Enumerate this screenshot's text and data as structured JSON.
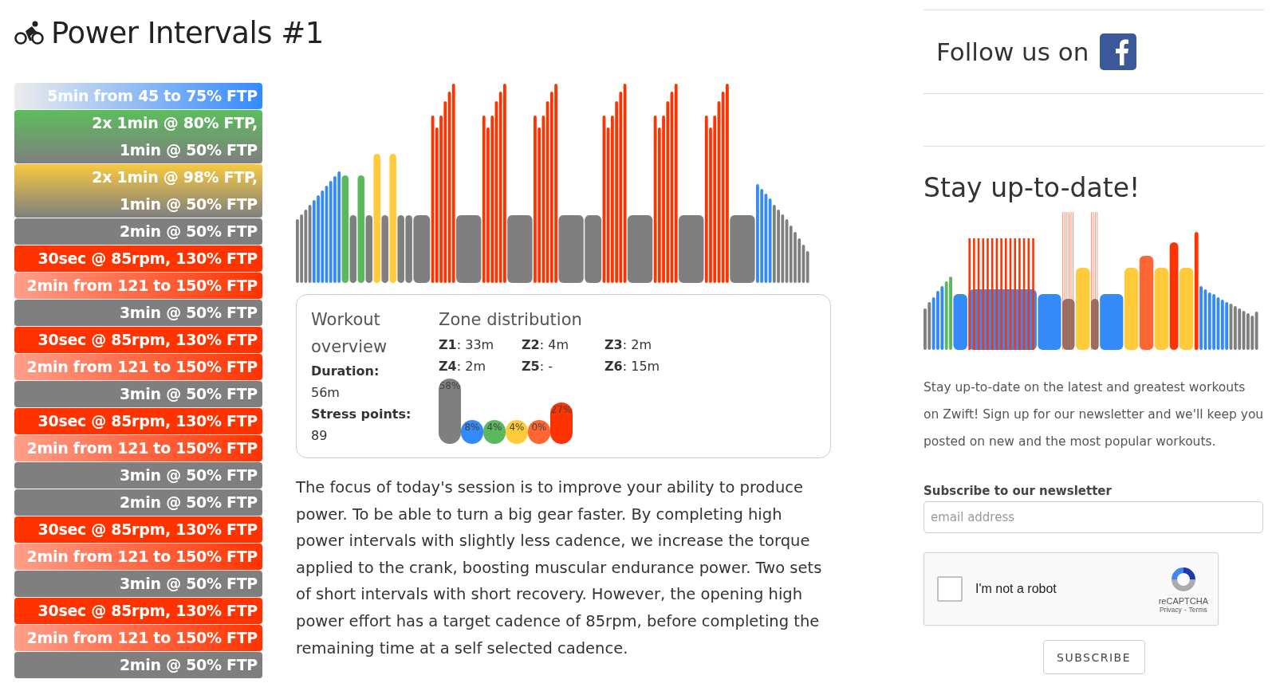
{
  "title": "Power Intervals #1",
  "intervals": [
    {
      "kind": "warmup",
      "lines": [
        "5min from 45 to 75% FTP"
      ]
    },
    {
      "kind": "tempo",
      "lines": [
        "2x 1min @ 80% FTP,",
        "1min @ 50% FTP"
      ]
    },
    {
      "kind": "threshold",
      "lines": [
        "2x 1min @ 98% FTP,",
        "1min @ 50% FTP"
      ]
    },
    {
      "kind": "recovery",
      "lines": [
        "2min @ 50% FTP"
      ]
    },
    {
      "kind": "effort",
      "lines": [
        "30sec @ 85rpm, 130% FTP"
      ]
    },
    {
      "kind": "ramp",
      "lines": [
        "2min from 121 to 150% FTP"
      ]
    },
    {
      "kind": "recovery",
      "lines": [
        "3min @ 50% FTP"
      ]
    },
    {
      "kind": "effort",
      "lines": [
        "30sec @ 85rpm, 130% FTP"
      ]
    },
    {
      "kind": "ramp",
      "lines": [
        "2min from 121 to 150% FTP"
      ]
    },
    {
      "kind": "recovery",
      "lines": [
        "3min @ 50% FTP"
      ]
    },
    {
      "kind": "effort",
      "lines": [
        "30sec @ 85rpm, 130% FTP"
      ]
    },
    {
      "kind": "ramp",
      "lines": [
        "2min from 121 to 150% FTP"
      ]
    },
    {
      "kind": "recovery",
      "lines": [
        "3min @ 50% FTP"
      ]
    },
    {
      "kind": "recovery",
      "lines": [
        "2min @ 50% FTP"
      ]
    },
    {
      "kind": "effort",
      "lines": [
        "30sec @ 85rpm, 130% FTP"
      ]
    },
    {
      "kind": "ramp",
      "lines": [
        "2min from 121 to 150% FTP"
      ]
    },
    {
      "kind": "recovery",
      "lines": [
        "3min @ 50% FTP"
      ]
    },
    {
      "kind": "effort",
      "lines": [
        "30sec @ 85rpm, 130% FTP"
      ]
    },
    {
      "kind": "ramp",
      "lines": [
        "2min from 121 to 150% FTP"
      ]
    },
    {
      "kind": "recovery",
      "lines": [
        "2min @ 50% FTP"
      ]
    }
  ],
  "overview": {
    "title": "Workout overview",
    "stats": [
      "**Duration:** 56m",
      "**Stress points:** 89"
    ],
    "zone_title": "Zone distribution",
    "zones": [
      "**Z1**: 33m",
      "**Z2**: 4m",
      "**Z3**: 2m",
      "**Z4**: 2m",
      "**Z5**: -",
      "**Z6**: 15m"
    ],
    "zone_bars": [
      {
        "label": "58%",
        "color": "#7f7f7f"
      },
      {
        "label": "8%",
        "color": "#338af8"
      },
      {
        "label": "4%",
        "color": "#5cb85c"
      },
      {
        "label": "4%",
        "color": "#ffcb3b"
      },
      {
        "label": "0%",
        "color": "#ff6633"
      },
      {
        "label": "27%",
        "color": "#ff3300"
      }
    ]
  },
  "description": "The focus of today's session is to improve your ability to produce power. To be able to turn a big gear faster. By completing high power intervals with slightly less cadence, we increase the torque applied to the crank, boosting muscular endurance power. Two sets of short intervals with short recovery. However, the opening high power effort has a target cadence of 85rpm, before completing the remaining time at a self selected cadence.",
  "sidebar": {
    "follow_text": "Follow us on",
    "heading": "Stay up-to-date!",
    "text": "Stay up-to-date on the latest and greatest workouts on Zwift! Sign up for our newsletter and we'll keep you posted on new and the most popular workouts.",
    "form_label": "Subscribe to our newsletter",
    "placeholder": "email address",
    "captcha": {
      "label": "I'm not a robot",
      "checked": false,
      "brand": "reCAPTCHA",
      "privacy": "Privacy",
      "separator": "-",
      "terms": "Terms"
    },
    "button": "SUBSCRIBE"
  }
}
